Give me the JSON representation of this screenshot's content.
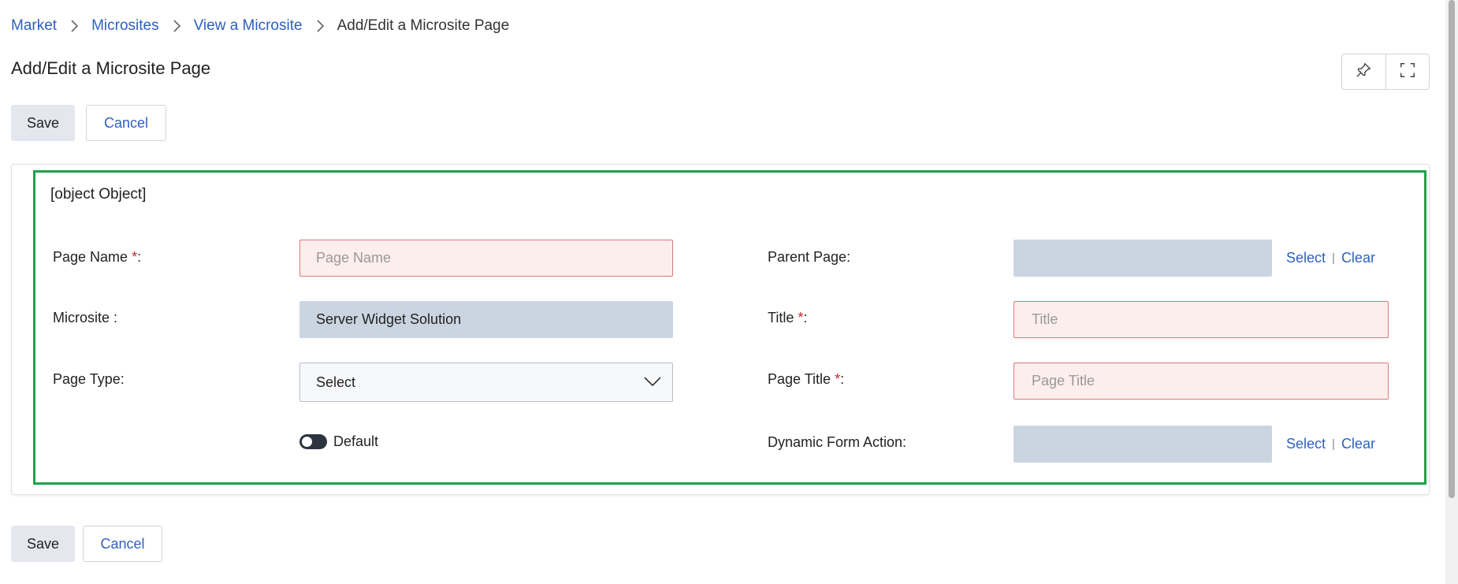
{
  "breadcrumb": {
    "items": [
      "Market",
      "Microsites",
      "View a Microsite"
    ],
    "current": "Add/Edit a Microsite Page"
  },
  "page_title": "Add/Edit a Microsite Page",
  "toolbar": {
    "save_label": "Save",
    "cancel_label": "Cancel"
  },
  "section": {
    "title": {
      "label": "Title ",
      "required": "*",
      "suffix": ":",
      "placeholder": "Title"
    },
    "page_name": {
      "label": "Page Name ",
      "required": "*",
      "suffix": ":",
      "placeholder": "Page Name",
      "value": ""
    },
    "microsite": {
      "label": "Microsite :",
      "value": "Server Widget Solution"
    },
    "page_type": {
      "label": "Page Type:",
      "value": "Select"
    },
    "default_toggle": {
      "label": "Default",
      "on": false
    },
    "parent_page": {
      "label": "Parent Page:",
      "value": "",
      "select_label": "Select",
      "clear_label": "Clear",
      "separator": "|"
    },
    "page_title": {
      "label": "Page Title ",
      "required": "*",
      "suffix": ":",
      "placeholder": "Page Title"
    },
    "dynamic_form_action": {
      "label": "Dynamic Form Action:",
      "value": "",
      "select_label": "Select",
      "clear_label": "Clear",
      "separator": "|"
    }
  },
  "colors": {
    "link": "#2f5fbf",
    "highlight_border": "#1fa24a",
    "error_bg": "#fdeeee",
    "error_border": "#d97a7a",
    "readonly_bg": "#cbd5e1",
    "required": "#c0272d"
  },
  "icons": {
    "pin": "pin-icon",
    "fullscreen": "fullscreen-icon",
    "breadcrumb_separator": "chevron-right-icon",
    "dropdown": "chevron-down-icon"
  }
}
